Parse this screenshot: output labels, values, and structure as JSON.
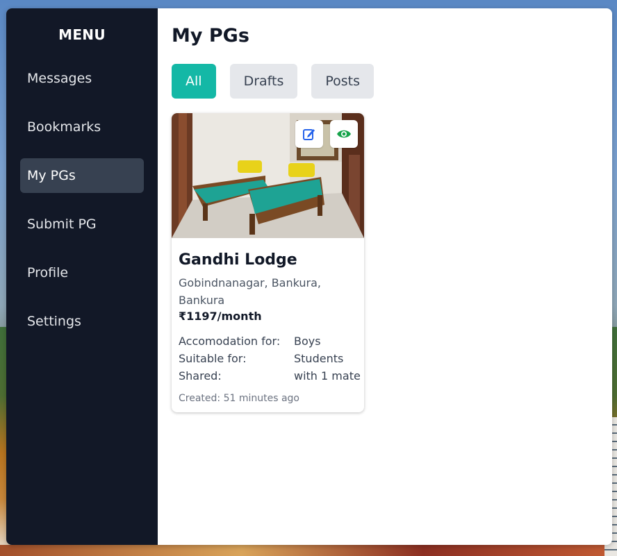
{
  "sidebar": {
    "title": "MENU",
    "items": [
      {
        "label": "Messages"
      },
      {
        "label": "Bookmarks"
      },
      {
        "label": "My PGs"
      },
      {
        "label": "Submit PG"
      },
      {
        "label": "Profile"
      },
      {
        "label": "Settings"
      }
    ],
    "active_item": "My PGs"
  },
  "main": {
    "title": "My PGs",
    "tabs": [
      {
        "label": "All"
      },
      {
        "label": "Drafts"
      },
      {
        "label": "Posts"
      }
    ],
    "active_tab": "All"
  },
  "listing": {
    "name": "Gandhi Lodge",
    "address": "Gobindnanagar, Bankura, Bankura",
    "price": "₹1197/month",
    "detail_labels": [
      "Accomodation for:",
      "Suitable for:",
      "Shared:"
    ],
    "detail_values": [
      "Boys",
      "Students",
      "with 1 mate"
    ],
    "created": "Created: 51 minutes ago",
    "actions": [
      "edit-icon",
      "eye-icon"
    ]
  },
  "colors": {
    "sidebar_bg": "#121827",
    "sidebar_active_bg": "#374151",
    "accent_teal": "#14b8a6",
    "tab_inactive_bg": "#e5e7eb",
    "edit_icon": "#2563eb",
    "view_icon": "#16a34a"
  }
}
